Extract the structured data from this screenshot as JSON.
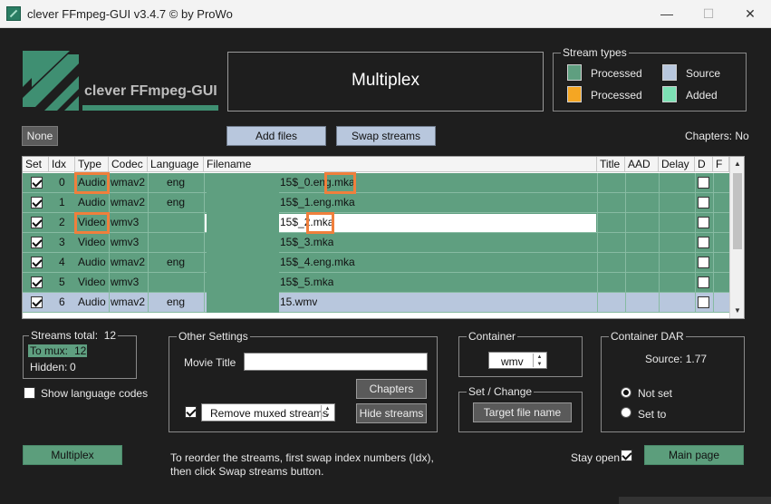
{
  "window": {
    "title": "clever FFmpeg-GUI v3.4.7   © by ProWo",
    "controls": {
      "minimize": "—",
      "maximize": "☐",
      "close": "✕"
    }
  },
  "logo": {
    "text": "clever FFmpeg-GUI"
  },
  "header": {
    "title": "Multiplex"
  },
  "stream_types": {
    "label": "Stream types",
    "items": [
      {
        "label": "Processed",
        "color": "#5f9f80"
      },
      {
        "label": "Source",
        "color": "#b8c7dd"
      },
      {
        "label": "Processed",
        "color": "#f5a623"
      },
      {
        "label": "Added",
        "color": "#7de0b4"
      }
    ]
  },
  "toolbar": {
    "none_label": "None",
    "add_files_label": "Add files",
    "swap_streams_label": "Swap streams",
    "chapters_status": "Chapters: No"
  },
  "table": {
    "columns": [
      "Set",
      "Idx",
      "Type",
      "Codec",
      "Language",
      "Filename",
      "Title",
      "AAD",
      "Delay",
      "D",
      "F"
    ],
    "rows": [
      {
        "set": true,
        "idx": "0",
        "type": "Audio",
        "codec": "wmav2",
        "language": "eng",
        "filename": "15$_0.eng.mka",
        "highlighted": false
      },
      {
        "set": true,
        "idx": "1",
        "type": "Audio",
        "codec": "wmav2",
        "language": "eng",
        "filename": "15$_1.eng.mka",
        "highlighted": false
      },
      {
        "set": true,
        "idx": "2",
        "type": "Video",
        "codec": "wmv3",
        "language": "",
        "filename": "15$_2.mka",
        "highlighted": true
      },
      {
        "set": true,
        "idx": "3",
        "type": "Video",
        "codec": "wmv3",
        "language": "",
        "filename": "15$_3.mka",
        "highlighted": false
      },
      {
        "set": true,
        "idx": "4",
        "type": "Audio",
        "codec": "wmav2",
        "language": "eng",
        "filename": "15$_4.eng.mka",
        "highlighted": false
      },
      {
        "set": true,
        "idx": "5",
        "type": "Video",
        "codec": "wmv3",
        "language": "",
        "filename": "15$_5.mka",
        "highlighted": false
      },
      {
        "set": true,
        "idx": "6",
        "type": "Audio",
        "codec": "wmav2",
        "language": "eng",
        "filename": "15.wmv",
        "highlighted": false,
        "selected": true
      }
    ]
  },
  "streams": {
    "total_label": "Streams total:",
    "total": "12",
    "to_mux_label": "To mux:",
    "to_mux": "12",
    "hidden_label": "Hidden:",
    "hidden": "0"
  },
  "show_language_codes": {
    "label": "Show language codes",
    "checked": false
  },
  "other_settings": {
    "label": "Other Settings",
    "movie_title_label": "Movie Title",
    "movie_title_value": "",
    "chapters_label": "Chapters",
    "remove_muxed_label": "Remove muxed streams",
    "remove_muxed_checked": true,
    "hide_streams_label": "Hide streams"
  },
  "container": {
    "label": "Container",
    "value": "wmv"
  },
  "set_change": {
    "label": "Set / Change",
    "target_label": "Target file name"
  },
  "container_dar": {
    "label": "Container DAR",
    "source_label": "Source: 1.77",
    "options": [
      "Not set",
      "Set to"
    ],
    "selected": "Not set"
  },
  "footer": {
    "multiplex_label": "Multiplex",
    "hint_line1": "To reorder the streams, first swap index numbers (Idx),",
    "hint_line2": " then click Swap streams button.",
    "stay_open_label": "Stay open",
    "stay_open_checked": true,
    "main_page_label": "Main page"
  }
}
